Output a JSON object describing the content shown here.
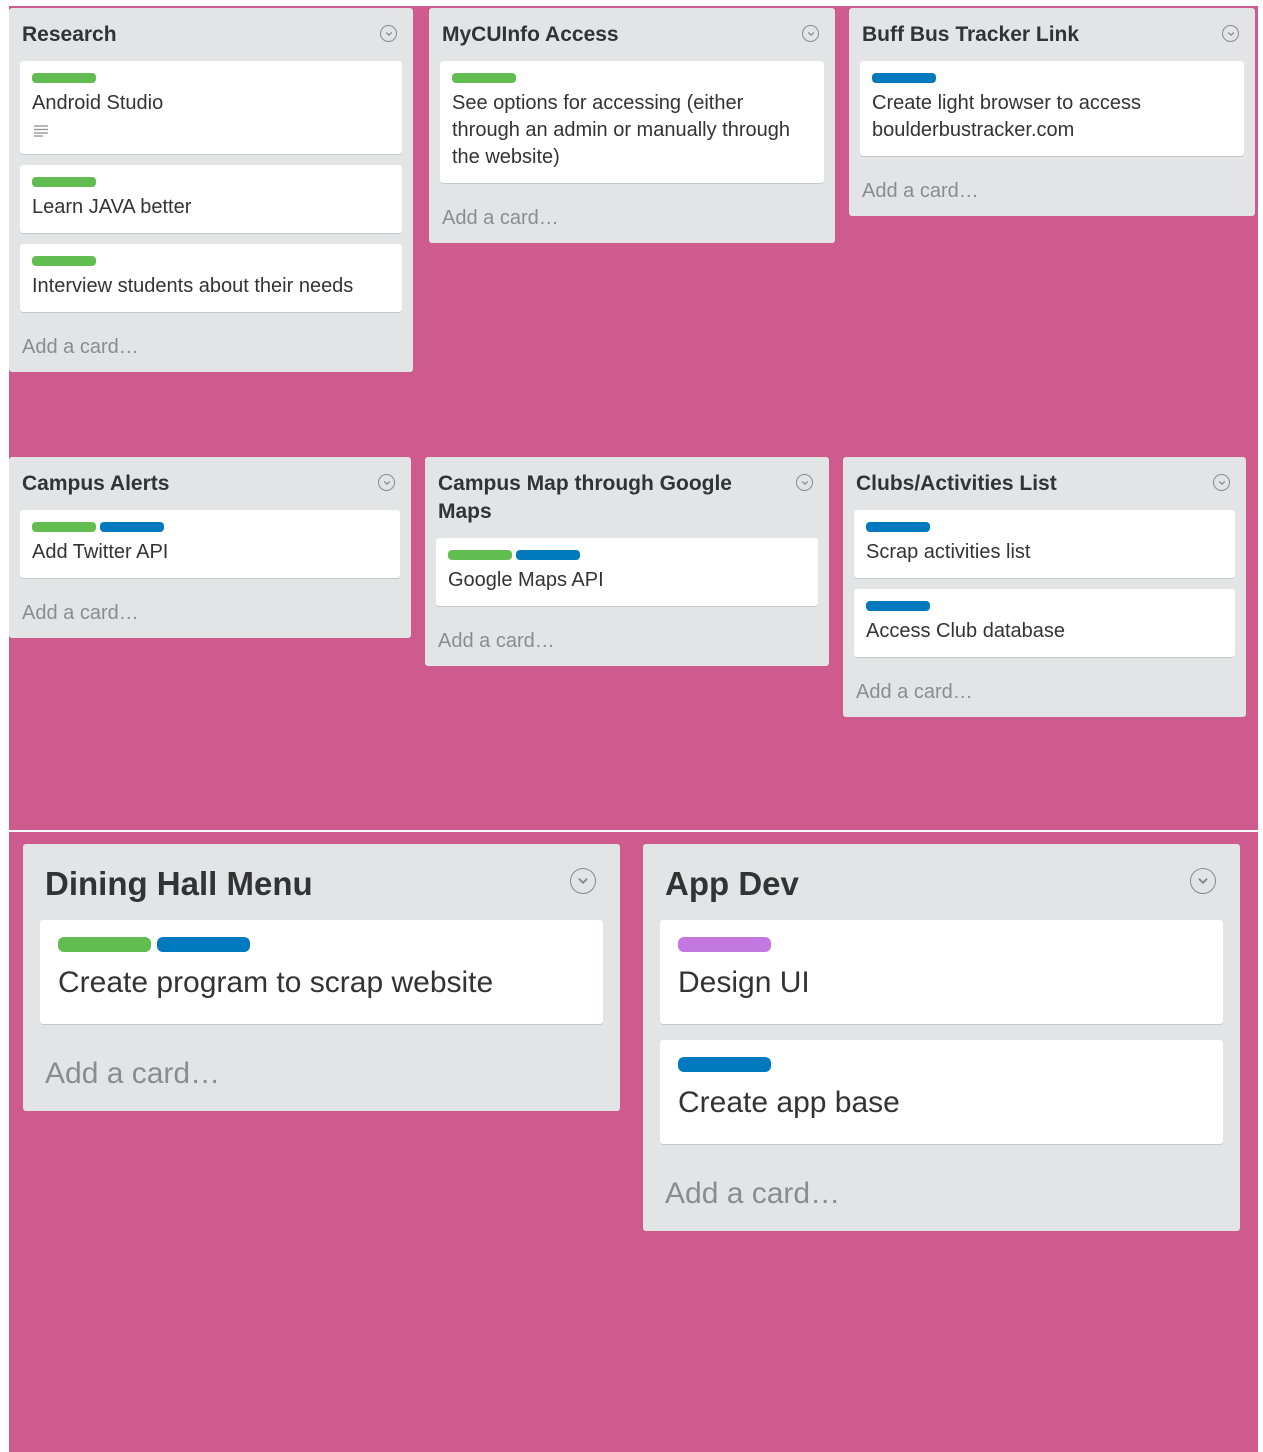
{
  "colors": {
    "board_background": "#cf5a8d",
    "list_background": "#e2e4e6",
    "card_background": "#ffffff",
    "label_green": "#61bd4f",
    "label_blue": "#0079bf",
    "label_purple": "#c377e0"
  },
  "lists": [
    {
      "title": "Research",
      "cards": [
        {
          "labels": [
            "green"
          ],
          "title": "Android Studio",
          "has_description": true
        },
        {
          "labels": [
            "green"
          ],
          "title": "Learn JAVA better"
        },
        {
          "labels": [
            "green"
          ],
          "title": "Interview students about their needs"
        }
      ],
      "add_card": "Add a card…"
    },
    {
      "title": "MyCUInfo Access",
      "cards": [
        {
          "labels": [
            "green"
          ],
          "title": "See options for accessing (either through an admin or manually through the website)"
        }
      ],
      "add_card": "Add a card…"
    },
    {
      "title": "Buff Bus Tracker Link",
      "cards": [
        {
          "labels": [
            "blue"
          ],
          "title": "Create light browser to access boulderbustracker.com"
        }
      ],
      "add_card": "Add a card…"
    },
    {
      "title": "Campus Alerts",
      "cards": [
        {
          "labels": [
            "green",
            "blue"
          ],
          "title": "Add Twitter API"
        }
      ],
      "add_card": "Add a card…"
    },
    {
      "title": "Campus Map through Google Maps",
      "cards": [
        {
          "labels": [
            "green",
            "blue"
          ],
          "title": "Google Maps API"
        }
      ],
      "add_card": "Add a card…"
    },
    {
      "title": "Clubs/Activities List",
      "cards": [
        {
          "labels": [
            "blue"
          ],
          "title": "Scrap activities list"
        },
        {
          "labels": [
            "blue"
          ],
          "title": "Access Club database"
        }
      ],
      "add_card": "Add a card…"
    },
    {
      "title": "Dining Hall Menu",
      "cards": [
        {
          "labels": [
            "green",
            "blue"
          ],
          "title": "Create program to scrap website"
        }
      ],
      "add_card": "Add a card…"
    },
    {
      "title": "App Dev",
      "cards": [
        {
          "labels": [
            "purple"
          ],
          "title": "Design UI"
        },
        {
          "labels": [
            "blue"
          ],
          "title": "Create app base"
        }
      ],
      "add_card": "Add a card…"
    }
  ],
  "icons": {
    "list_menu": "chevron-down-circle-icon",
    "card_description": "description-lines-icon"
  }
}
